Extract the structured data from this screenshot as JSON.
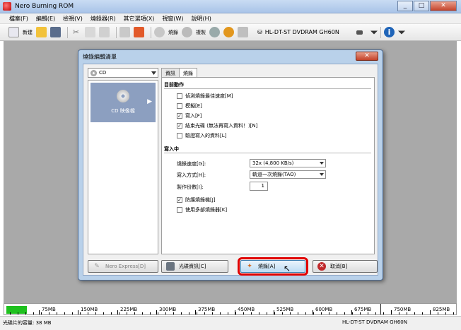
{
  "app": {
    "title": "Nero Burning ROM",
    "window_buttons": [
      "_",
      "□",
      "✕"
    ]
  },
  "menubar": [
    "檔案(F)",
    "編輯(E)",
    "檢視(V)",
    "燒錄器(R)",
    "其它選項(X)",
    "視窗(W)",
    "說明(H)"
  ],
  "toolbar": {
    "new_label": "新建",
    "burn_label": "燒錄",
    "copy_label": "複製",
    "drive": "HL-DT-ST DVDRAM GH60N"
  },
  "dialog": {
    "title": "燒錄編輯清單",
    "close": "✕",
    "disc_type": "CD",
    "side_item_label": "CD 映像檔",
    "tabs": [
      "資訊",
      "燒錄"
    ],
    "action_section": "目前動作",
    "actions": [
      {
        "label": "偵測燒錄最佳速度[M]",
        "checked": false
      },
      {
        "label": "模擬[E]",
        "checked": false
      },
      {
        "label": "寫入[F]",
        "checked": true
      },
      {
        "label": "結束光碟 (無法再寫入資料！)[N]",
        "checked": true
      },
      {
        "label": "驗證寫入的資料[L]",
        "checked": false
      }
    ],
    "write_section": "寫入中",
    "write_speed_label": "燒錄速度[G]:",
    "write_speed_value": "32x (4,800 KB/s)",
    "write_method_label": "寫入方式[H]:",
    "write_method_value": "軌道一次燒錄(TAO)",
    "copies_label": "製作份數[I]:",
    "copies_value": "1",
    "options": [
      {
        "label": "防護燒錄機[J]",
        "checked": true
      },
      {
        "label": "使用多部燒錄器[K]",
        "checked": false
      }
    ],
    "buttons": {
      "nero_express": "Nero Express[D]",
      "disc_info": "光碟資訊[C]",
      "burn": "燒錄[A]",
      "cancel": "取消[B]"
    }
  },
  "capacity": {
    "used_fraction": 0.045,
    "marks": [
      "75MB",
      "150MB",
      "225MB",
      "300MB",
      "375MB",
      "450MB",
      "525MB",
      "600MB",
      "675MB",
      "750MB",
      "825MB"
    ]
  },
  "status": {
    "disc_usage": "光碟片的容量: 38 MB",
    "drive": "HL-DT-ST DVDRAM GH60N"
  },
  "colors": {
    "highlight": "#e00000",
    "progress": "#1fc11f",
    "dialog_frame": "#b9d1ea"
  }
}
